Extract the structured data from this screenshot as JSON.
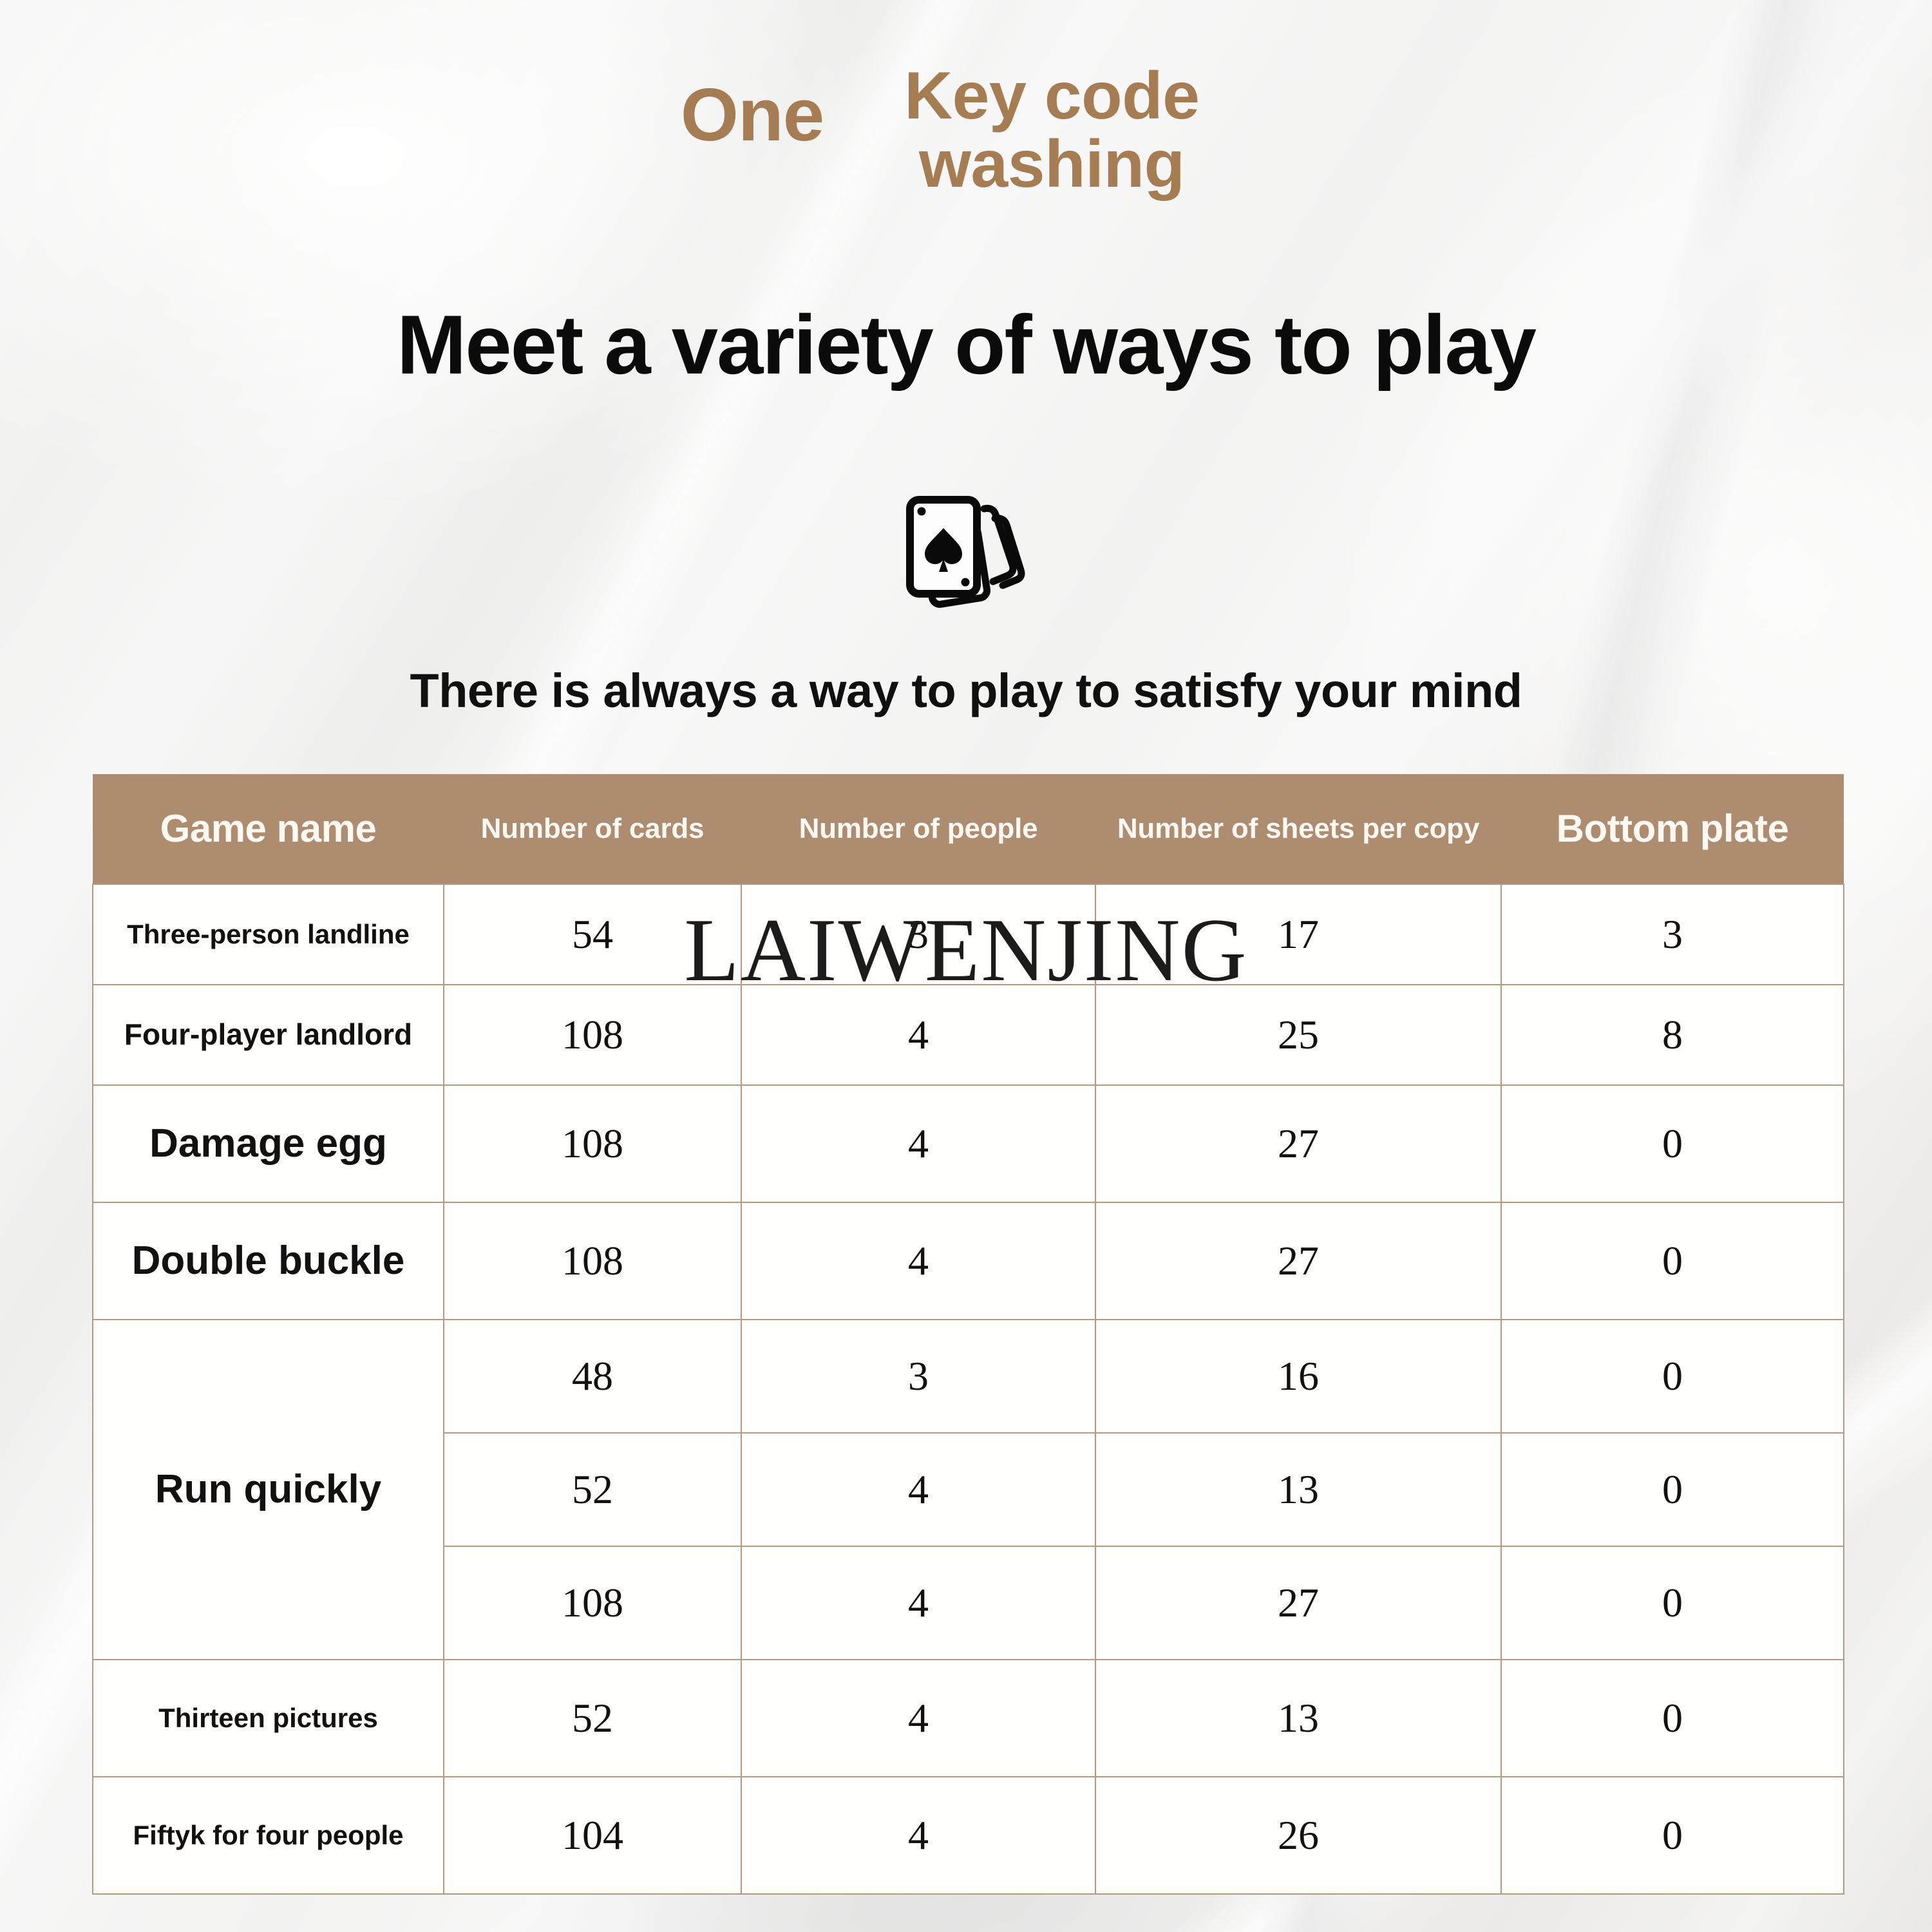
{
  "hero": {
    "kicker_one": "One",
    "kicker_main": "Key code washing",
    "headline": "Meet a variety of ways to play",
    "subtitle": "There is always a way to play to satisfy your mind",
    "icon": "playing-cards-icon"
  },
  "watermark": {
    "text": "LAIWENJING"
  },
  "colors": {
    "accent": "#ae8c70",
    "header_text": "#fdf8f2",
    "border": "#b59a80",
    "kicker": "#a67c52",
    "heading": "#0b0b0b",
    "background": "#f2f2f1"
  },
  "table": {
    "headers": [
      "Game name",
      "Number of cards",
      "Number of people",
      "Number of sheets per copy",
      "Bottom plate"
    ],
    "rows": [
      {
        "name": "Three-person landline",
        "cards": "54",
        "people": "3",
        "sheets": "17",
        "plate": "3"
      },
      {
        "name": "Four-player landlord",
        "cards": "108",
        "people": "4",
        "sheets": "25",
        "plate": "8"
      },
      {
        "name": "Damage egg",
        "cards": "108",
        "people": "4",
        "sheets": "27",
        "plate": "0"
      },
      {
        "name": "Double buckle",
        "cards": "108",
        "people": "4",
        "sheets": "27",
        "plate": "0"
      },
      {
        "name": "Run quickly",
        "cards": "48",
        "people": "3",
        "sheets": "16",
        "plate": "0"
      },
      {
        "name": "Run quickly",
        "cards": "52",
        "people": "4",
        "sheets": "13",
        "plate": "0"
      },
      {
        "name": "Run quickly",
        "cards": "108",
        "people": "4",
        "sheets": "27",
        "plate": "0"
      },
      {
        "name": "Thirteen pictures",
        "cards": "52",
        "people": "4",
        "sheets": "13",
        "plate": "0"
      },
      {
        "name": "Fiftyk for four people",
        "cards": "104",
        "people": "4",
        "sheets": "26",
        "plate": "0"
      }
    ],
    "group_label": "Run quickly"
  }
}
